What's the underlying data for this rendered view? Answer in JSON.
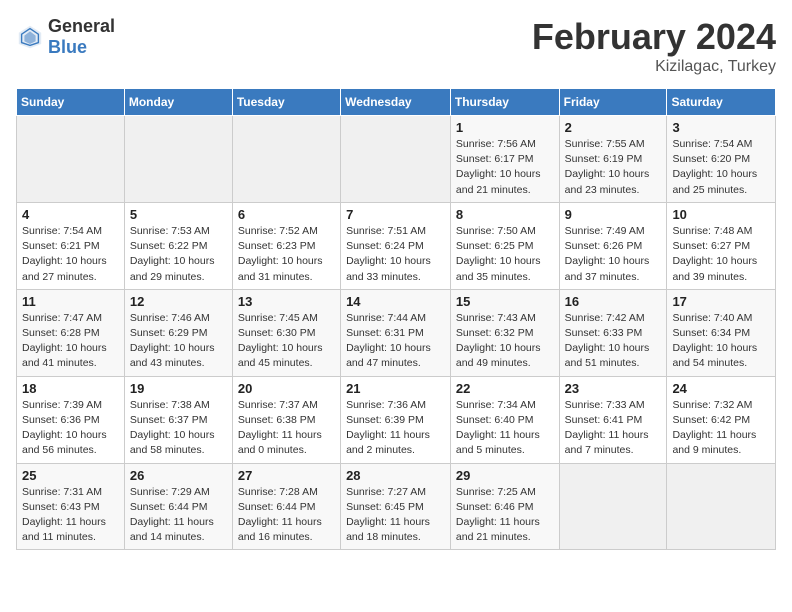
{
  "header": {
    "logo_general": "General",
    "logo_blue": "Blue",
    "month_year": "February 2024",
    "location": "Kizilagac, Turkey"
  },
  "days_of_week": [
    "Sunday",
    "Monday",
    "Tuesday",
    "Wednesday",
    "Thursday",
    "Friday",
    "Saturday"
  ],
  "weeks": [
    [
      {
        "day": "",
        "info": ""
      },
      {
        "day": "",
        "info": ""
      },
      {
        "day": "",
        "info": ""
      },
      {
        "day": "",
        "info": ""
      },
      {
        "day": "1",
        "info": "Sunrise: 7:56 AM\nSunset: 6:17 PM\nDaylight: 10 hours\nand 21 minutes."
      },
      {
        "day": "2",
        "info": "Sunrise: 7:55 AM\nSunset: 6:19 PM\nDaylight: 10 hours\nand 23 minutes."
      },
      {
        "day": "3",
        "info": "Sunrise: 7:54 AM\nSunset: 6:20 PM\nDaylight: 10 hours\nand 25 minutes."
      }
    ],
    [
      {
        "day": "4",
        "info": "Sunrise: 7:54 AM\nSunset: 6:21 PM\nDaylight: 10 hours\nand 27 minutes."
      },
      {
        "day": "5",
        "info": "Sunrise: 7:53 AM\nSunset: 6:22 PM\nDaylight: 10 hours\nand 29 minutes."
      },
      {
        "day": "6",
        "info": "Sunrise: 7:52 AM\nSunset: 6:23 PM\nDaylight: 10 hours\nand 31 minutes."
      },
      {
        "day": "7",
        "info": "Sunrise: 7:51 AM\nSunset: 6:24 PM\nDaylight: 10 hours\nand 33 minutes."
      },
      {
        "day": "8",
        "info": "Sunrise: 7:50 AM\nSunset: 6:25 PM\nDaylight: 10 hours\nand 35 minutes."
      },
      {
        "day": "9",
        "info": "Sunrise: 7:49 AM\nSunset: 6:26 PM\nDaylight: 10 hours\nand 37 minutes."
      },
      {
        "day": "10",
        "info": "Sunrise: 7:48 AM\nSunset: 6:27 PM\nDaylight: 10 hours\nand 39 minutes."
      }
    ],
    [
      {
        "day": "11",
        "info": "Sunrise: 7:47 AM\nSunset: 6:28 PM\nDaylight: 10 hours\nand 41 minutes."
      },
      {
        "day": "12",
        "info": "Sunrise: 7:46 AM\nSunset: 6:29 PM\nDaylight: 10 hours\nand 43 minutes."
      },
      {
        "day": "13",
        "info": "Sunrise: 7:45 AM\nSunset: 6:30 PM\nDaylight: 10 hours\nand 45 minutes."
      },
      {
        "day": "14",
        "info": "Sunrise: 7:44 AM\nSunset: 6:31 PM\nDaylight: 10 hours\nand 47 minutes."
      },
      {
        "day": "15",
        "info": "Sunrise: 7:43 AM\nSunset: 6:32 PM\nDaylight: 10 hours\nand 49 minutes."
      },
      {
        "day": "16",
        "info": "Sunrise: 7:42 AM\nSunset: 6:33 PM\nDaylight: 10 hours\nand 51 minutes."
      },
      {
        "day": "17",
        "info": "Sunrise: 7:40 AM\nSunset: 6:34 PM\nDaylight: 10 hours\nand 54 minutes."
      }
    ],
    [
      {
        "day": "18",
        "info": "Sunrise: 7:39 AM\nSunset: 6:36 PM\nDaylight: 10 hours\nand 56 minutes."
      },
      {
        "day": "19",
        "info": "Sunrise: 7:38 AM\nSunset: 6:37 PM\nDaylight: 10 hours\nand 58 minutes."
      },
      {
        "day": "20",
        "info": "Sunrise: 7:37 AM\nSunset: 6:38 PM\nDaylight: 11 hours\nand 0 minutes."
      },
      {
        "day": "21",
        "info": "Sunrise: 7:36 AM\nSunset: 6:39 PM\nDaylight: 11 hours\nand 2 minutes."
      },
      {
        "day": "22",
        "info": "Sunrise: 7:34 AM\nSunset: 6:40 PM\nDaylight: 11 hours\nand 5 minutes."
      },
      {
        "day": "23",
        "info": "Sunrise: 7:33 AM\nSunset: 6:41 PM\nDaylight: 11 hours\nand 7 minutes."
      },
      {
        "day": "24",
        "info": "Sunrise: 7:32 AM\nSunset: 6:42 PM\nDaylight: 11 hours\nand 9 minutes."
      }
    ],
    [
      {
        "day": "25",
        "info": "Sunrise: 7:31 AM\nSunset: 6:43 PM\nDaylight: 11 hours\nand 11 minutes."
      },
      {
        "day": "26",
        "info": "Sunrise: 7:29 AM\nSunset: 6:44 PM\nDaylight: 11 hours\nand 14 minutes."
      },
      {
        "day": "27",
        "info": "Sunrise: 7:28 AM\nSunset: 6:44 PM\nDaylight: 11 hours\nand 16 minutes."
      },
      {
        "day": "28",
        "info": "Sunrise: 7:27 AM\nSunset: 6:45 PM\nDaylight: 11 hours\nand 18 minutes."
      },
      {
        "day": "29",
        "info": "Sunrise: 7:25 AM\nSunset: 6:46 PM\nDaylight: 11 hours\nand 21 minutes."
      },
      {
        "day": "",
        "info": ""
      },
      {
        "day": "",
        "info": ""
      }
    ]
  ]
}
